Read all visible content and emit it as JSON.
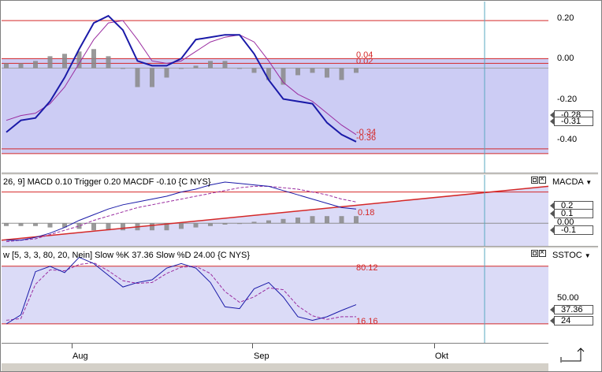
{
  "price_pane": {
    "ticks": [
      "0.20",
      "0.00",
      "-0.20",
      "-0.40"
    ],
    "value_boxes": [
      "-0.28",
      "-0.31"
    ],
    "channel_labels": [
      "0.04",
      "0.02",
      "-0.34",
      "-0.36"
    ]
  },
  "macd_pane": {
    "header": "26, 9] MACD 0.10 Trigger 0.20 MACDF -0.10 {C NYS}",
    "name": "MACDA",
    "line_label": "0.18",
    "value_boxes": [
      "0.2",
      "0.1",
      "0.00",
      "-0.1"
    ]
  },
  "stoch_pane": {
    "header": "w [5, 3, 3, 80, 20, Nein] Slow %K 37.36 Slow %D 24.00 {C NYS}",
    "name": "SSTOC",
    "upper_label": "80.12",
    "lower_label": "16.16",
    "ticks": [
      "50.00"
    ],
    "value_boxes": [
      "37.36",
      "24"
    ]
  },
  "x_axis": {
    "labels": [
      "Aug",
      "Sep",
      "Okt"
    ]
  },
  "colors": {
    "band_fill": "#ccccf4",
    "blue_line": "#1a1aa8",
    "purple_line": "#9a2ca0",
    "red_line": "#d42828",
    "histogram": "#888888",
    "cursor_line": "#5aa8c0"
  },
  "chart_data": [
    {
      "type": "line",
      "title": "",
      "series": [
        {
          "values": [
            -0.27,
            -0.22,
            -0.21,
            -0.14,
            -0.04,
            0.08,
            0.19,
            0.22,
            0.16,
            0.03,
            0.01,
            0.01,
            0.04,
            0.12,
            0.13,
            0.14,
            0.14,
            0.06,
            -0.05,
            -0.13,
            -0.14,
            -0.15,
            -0.23,
            -0.28,
            -0.31
          ]
        },
        {
          "values": [
            -0.22,
            -0.2,
            -0.19,
            -0.15,
            -0.08,
            0.02,
            0.12,
            0.19,
            0.2,
            0.12,
            0.03,
            0.02,
            0.03,
            0.07,
            0.11,
            0.13,
            0.14,
            0.11,
            0.03,
            -0.06,
            -0.11,
            -0.14,
            -0.19,
            -0.24,
            -0.28
          ]
        }
      ],
      "histogram": [
        0.02,
        0.02,
        0.03,
        0.05,
        0.06,
        0.07,
        0.08,
        0.05,
        0.0,
        -0.08,
        -0.08,
        -0.04,
        0.0,
        0.01,
        0.03,
        0.03,
        0.0,
        -0.02,
        -0.05,
        -0.07,
        -0.03,
        -0.02,
        -0.04,
        -0.05,
        -0.02
      ],
      "horizontal_lines": [
        0.2,
        0.04,
        0.02,
        -0.34,
        -0.36
      ],
      "ylim": [
        -0.44,
        0.28
      ]
    },
    {
      "type": "line",
      "title": "",
      "series": [
        {
          "values": [
            -0.12,
            -0.12,
            -0.1,
            -0.07,
            -0.03,
            0.02,
            0.06,
            0.1,
            0.13,
            0.15,
            0.17,
            0.19,
            0.22,
            0.24,
            0.27,
            0.29,
            0.28,
            0.27,
            0.26,
            0.23,
            0.2,
            0.17,
            0.14,
            0.11,
            0.1
          ]
        },
        {
          "values": [
            -0.13,
            -0.12,
            -0.11,
            -0.08,
            -0.05,
            -0.02,
            0.02,
            0.05,
            0.08,
            0.11,
            0.13,
            0.15,
            0.17,
            0.19,
            0.21,
            0.23,
            0.25,
            0.26,
            0.26,
            0.25,
            0.24,
            0.22,
            0.2,
            0.17,
            0.15
          ]
        }
      ],
      "histogram": [
        -0.02,
        -0.02,
        -0.02,
        -0.03,
        -0.03,
        -0.04,
        -0.05,
        -0.05,
        -0.05,
        -0.05,
        -0.05,
        -0.05,
        -0.04,
        -0.03,
        -0.02,
        -0.01,
        0.0,
        0.01,
        0.02,
        0.03,
        0.04,
        0.05,
        0.05,
        0.05,
        0.05
      ],
      "ylim": [
        -0.16,
        0.34
      ]
    },
    {
      "type": "line",
      "title": "",
      "series": [
        {
          "values": [
            16,
            26,
            74,
            80,
            73,
            90,
            83,
            70,
            57,
            62,
            65,
            78,
            83,
            78,
            62,
            35,
            33,
            55,
            62,
            46,
            24,
            20,
            24,
            31,
            37.36
          ]
        },
        {
          "values": [
            20,
            22,
            60,
            76,
            75,
            82,
            84,
            75,
            64,
            61,
            62,
            72,
            79,
            80,
            72,
            52,
            40,
            46,
            56,
            54,
            36,
            25,
            21,
            24,
            24
          ]
        }
      ],
      "horizontal_lines": [
        80.12,
        16.16
      ],
      "ylim": [
        -5,
        100
      ]
    }
  ]
}
